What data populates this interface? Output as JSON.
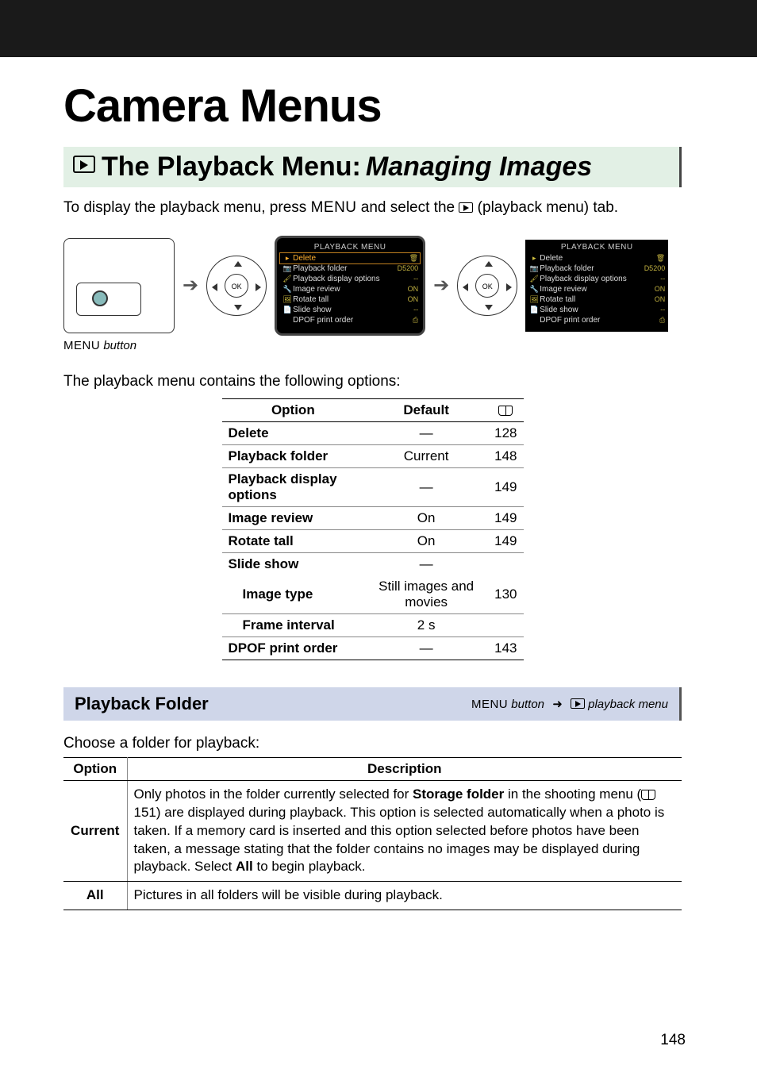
{
  "blackbar": true,
  "title": "Camera Menus",
  "section": {
    "bold": "The Playback Menu:",
    "italic": "Managing Images"
  },
  "intro_before": "To display the playback menu, press ",
  "intro_menu": "MENU",
  "intro_mid": " and select the ",
  "intro_after": " (playback menu) tab.",
  "lcd_title": "PLAYBACK MENU",
  "lcd_items": [
    {
      "label": "Delete",
      "val": "🗑"
    },
    {
      "label": "Playback folder",
      "val": "D5200"
    },
    {
      "label": "Playback display options",
      "val": "--"
    },
    {
      "label": "Image review",
      "val": "ON"
    },
    {
      "label": "Rotate tall",
      "val": "ON"
    },
    {
      "label": "Slide show",
      "val": "--"
    },
    {
      "label": "DPOF print order",
      "val": "⎙"
    }
  ],
  "caption_menu": "MENU",
  "caption_italic": " button",
  "para2": "The playback menu contains the following options:",
  "opts_head": {
    "option": "Option",
    "default": "Default"
  },
  "opts": [
    {
      "opt": "Delete",
      "def": "—",
      "pg": "128",
      "bold": true
    },
    {
      "opt": "Playback folder",
      "def": "Current",
      "pg": "148",
      "bold": true
    },
    {
      "opt": "Playback display options",
      "def": "—",
      "pg": "149",
      "bold": true
    },
    {
      "opt": "Image review",
      "def": "On",
      "pg": "149",
      "bold": true
    },
    {
      "opt": "Rotate tall",
      "def": "On",
      "pg": "149",
      "bold": true
    },
    {
      "opt": "Slide show",
      "def": "—",
      "pg": "",
      "bold": true,
      "noborder": true
    },
    {
      "opt": "Image type",
      "def": "Still images and movies",
      "pg": "130",
      "bold": true,
      "indent": true
    },
    {
      "opt": "Frame interval",
      "def": "2 s",
      "pg": "",
      "bold": true,
      "indent": true
    },
    {
      "opt": "DPOF print order",
      "def": "—",
      "pg": "143",
      "bold": true
    }
  ],
  "bluebar": {
    "left": "Playback Folder",
    "right_menu": "MENU",
    "right_button": " button",
    "right_play": " playback menu"
  },
  "choose": "Choose a folder for playback:",
  "desc_head": {
    "option": "Option",
    "desc": "Description"
  },
  "desc": [
    {
      "opt": "Current",
      "text_parts": [
        "Only photos in the folder currently selected for ",
        {
          "bold": "Storage folder"
        },
        " in the shooting menu (",
        {
          "book": true
        },
        " 151) are displayed during playback.  This option is selected automatically when a photo is taken.  If a memory card is inserted and this option selected before photos have been taken, a message stating that the folder contains no images may be displayed during playback.  Select ",
        {
          "bold": "All"
        },
        " to begin playback."
      ]
    },
    {
      "opt": "All",
      "text": "Pictures in all folders will be visible during playback."
    }
  ],
  "page": "148"
}
